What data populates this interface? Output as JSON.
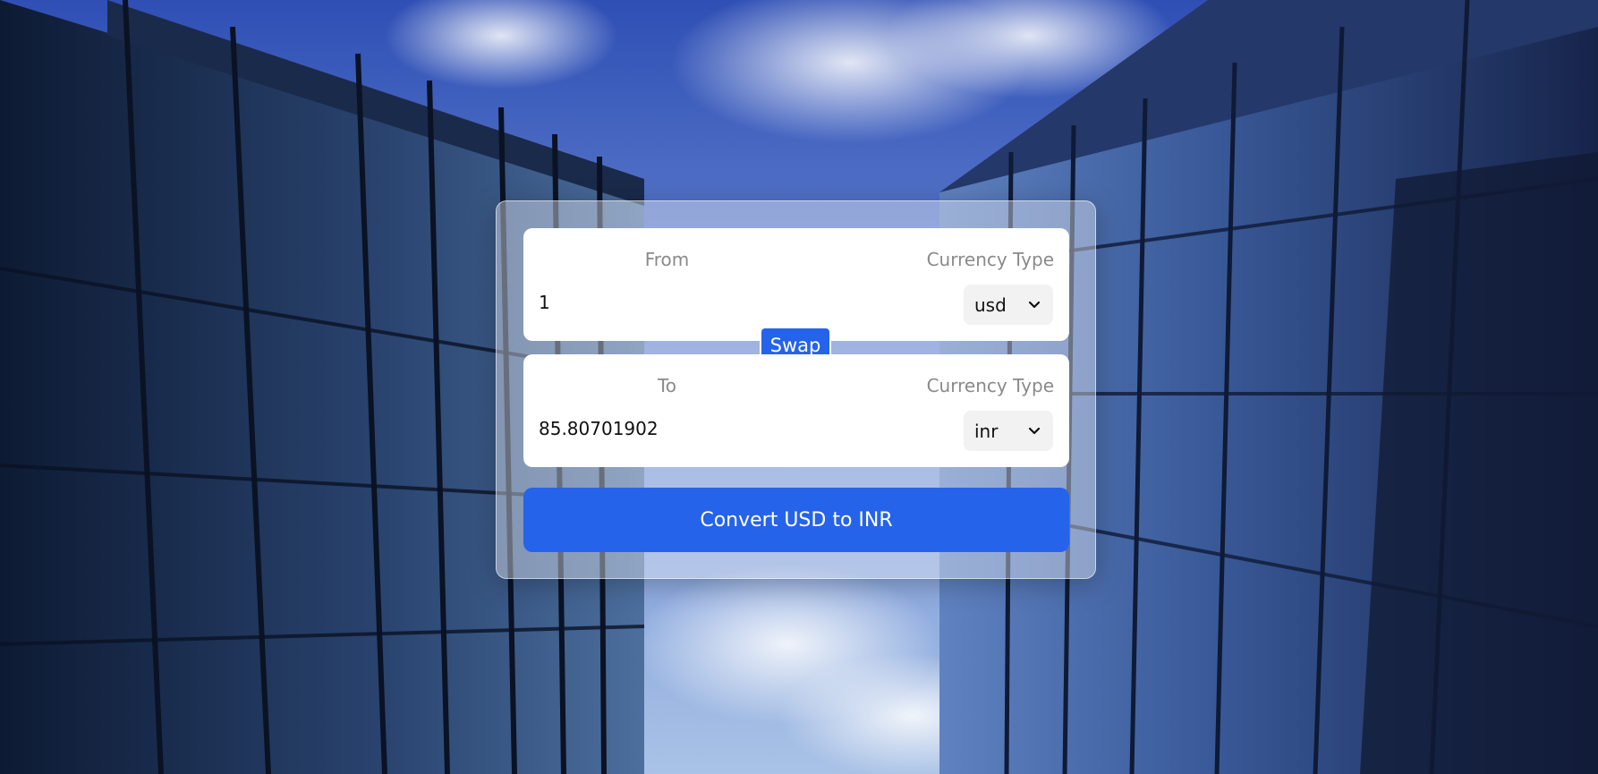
{
  "from": {
    "label": "From",
    "currency_label": "Currency Type",
    "amount": "1",
    "currency": "usd"
  },
  "to": {
    "label": "To",
    "currency_label": "Currency Type",
    "amount": "85.80701902",
    "currency": "inr"
  },
  "swap_label": "Swap",
  "convert_label": "Convert USD to INR",
  "colors": {
    "accent": "#2563eb",
    "card_bg": "#ffffff",
    "muted_text": "#8a8a8a"
  },
  "icons": {
    "select_arrow": "chevron-down-icon"
  }
}
